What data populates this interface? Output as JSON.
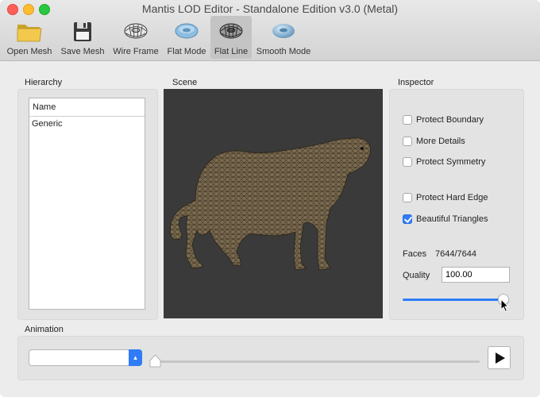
{
  "window": {
    "title": "Mantis LOD Editor - Standalone Edition v3.0 (Metal)"
  },
  "toolbar": {
    "items": [
      {
        "label": "Open Mesh",
        "icon": "folder-icon"
      },
      {
        "label": "Save Mesh",
        "icon": "floppy-disk-icon"
      },
      {
        "label": "Wire Frame",
        "icon": "wireframe-torus-icon"
      },
      {
        "label": "Flat Mode",
        "icon": "flat-torus-icon"
      },
      {
        "label": "Flat Line",
        "icon": "flat-line-torus-icon",
        "active": true
      },
      {
        "label": "Smooth Mode",
        "icon": "smooth-torus-icon"
      }
    ]
  },
  "hierarchy": {
    "title": "Hierarchy",
    "column_header": "Name",
    "rows": [
      "Generic"
    ]
  },
  "scene": {
    "title": "Scene",
    "background": "#3a3a3a",
    "mesh_color": "#8a7a5e"
  },
  "inspector": {
    "title": "Inspector",
    "checkboxes": [
      {
        "label": "Protect Boundary",
        "checked": false
      },
      {
        "label": "More Details",
        "checked": false
      },
      {
        "label": "Protect Symmetry",
        "checked": false
      },
      {
        "label": "Protect Hard Edge",
        "checked": false
      },
      {
        "label": "Beautiful Triangles",
        "checked": true
      }
    ],
    "faces_label": "Faces",
    "faces_value": "7644/7644",
    "quality_label": "Quality",
    "quality_value": "100.00",
    "slider_level": 1.0,
    "accent": "#2f7cf6"
  },
  "animation": {
    "title": "Animation",
    "selected": "",
    "timeline_level": 0.0
  }
}
